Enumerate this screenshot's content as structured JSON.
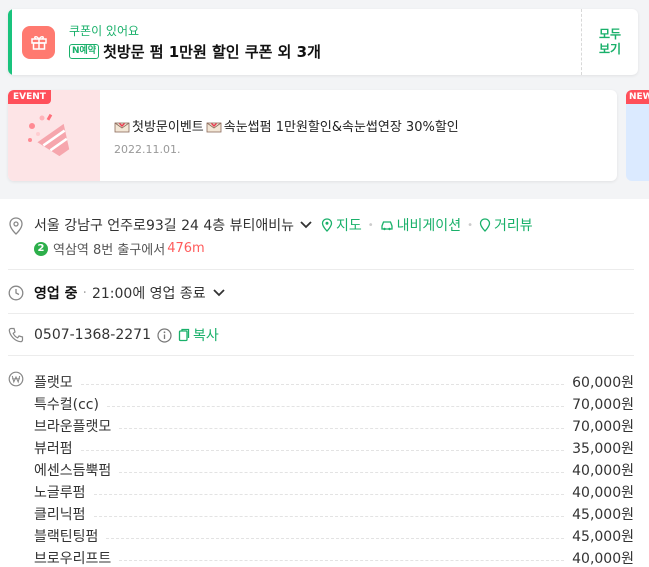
{
  "coupon": {
    "subtitle": "쿠폰이 있어요",
    "badge": "N예약",
    "title": "첫방문 펌 1만원 할인 쿠폰 외 3개",
    "see_all_line1": "모두",
    "see_all_line2": "보기"
  },
  "event": {
    "badge": "EVENT",
    "title": "첫방문이벤트",
    "title2": "속눈썹펌 1만원할인&속눈썹연장 30%할인",
    "date": "2022.11.01.",
    "next_badge": "NEW"
  },
  "address": {
    "text": "서울 강남구 언주로93길 24 4층 뷰티애비뉴",
    "map": "지도",
    "navigation": "내비게이션",
    "street_view": "거리뷰",
    "subway_line": "2",
    "subway_text": "역삼역 8번 출구에서",
    "distance": "476m"
  },
  "hours": {
    "status": "영업 중",
    "detail": "21:00에 영업 종료"
  },
  "phone": {
    "number": "0507-1368-2271",
    "copy": "복사"
  },
  "prices": [
    {
      "name": "플랫모",
      "price": "60,000원"
    },
    {
      "name": "특수컬(cc)",
      "price": "70,000원"
    },
    {
      "name": "브라운플랫모",
      "price": "70,000원"
    },
    {
      "name": "뷰러펌",
      "price": "35,000원"
    },
    {
      "name": "에센스듬뿍펌",
      "price": "40,000원"
    },
    {
      "name": "노글루펌",
      "price": "40,000원"
    },
    {
      "name": "클리닉펌",
      "price": "45,000원"
    },
    {
      "name": "블랙틴팅펌",
      "price": "45,000원"
    },
    {
      "name": "브로우리프트",
      "price": "40,000원"
    }
  ],
  "colors": {
    "accent": "#19b06a",
    "distance": "#ff5c5c",
    "event_badge": "#ff4f5a"
  }
}
